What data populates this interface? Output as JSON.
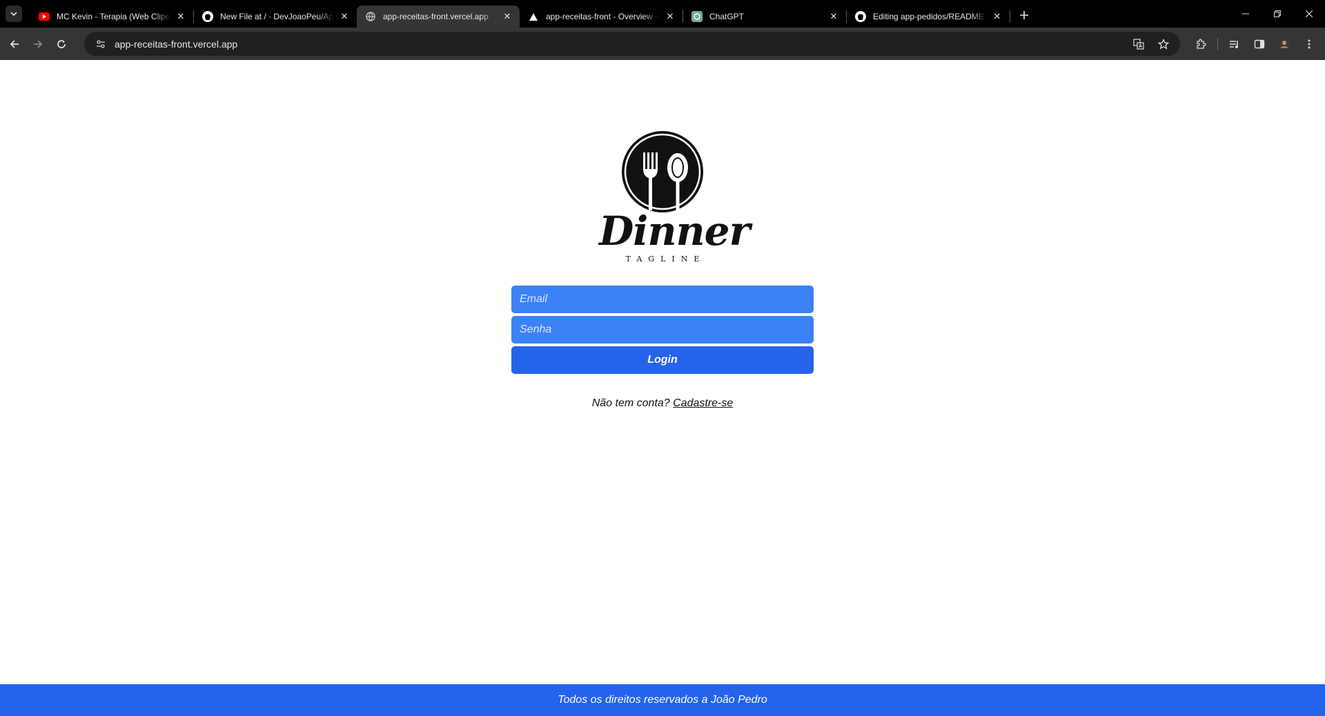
{
  "browser": {
    "tabs": [
      {
        "title": "MC Kevin - Terapia (Web Clipe)",
        "favicon": "youtube-icon",
        "active": false
      },
      {
        "title": "New File at / · DevJoaoPeu/App",
        "favicon": "github-icon",
        "active": false
      },
      {
        "title": "app-receitas-front.vercel.app",
        "favicon": "globe-icon",
        "active": true
      },
      {
        "title": "app-receitas-front - Overview –",
        "favicon": "vercel-icon",
        "active": false
      },
      {
        "title": "ChatGPT",
        "favicon": "chatgpt-icon",
        "active": false
      },
      {
        "title": "Editing app-pedidos/README.m",
        "favicon": "github-icon",
        "active": false
      }
    ],
    "url": "app-receitas-front.vercel.app",
    "colors": {
      "tabbar": "#000000",
      "toolbar": "#333537",
      "omnibox": "#1f2021"
    }
  },
  "logo": {
    "name": "Dinner",
    "tagline": "TAGLINE",
    "icon": "fork-spoon-plate-icon"
  },
  "login": {
    "email_placeholder": "Email",
    "password_placeholder": "Senha",
    "button_label": "Login",
    "colors": {
      "input_bg": "#3b82f6",
      "button_bg": "#2563eb"
    }
  },
  "signup": {
    "prompt": "Não tem conta?",
    "link_label": "Cadastre-se"
  },
  "footer": {
    "text": "Todos os direitos reservados a João Pedro",
    "color": "#2563eb"
  }
}
